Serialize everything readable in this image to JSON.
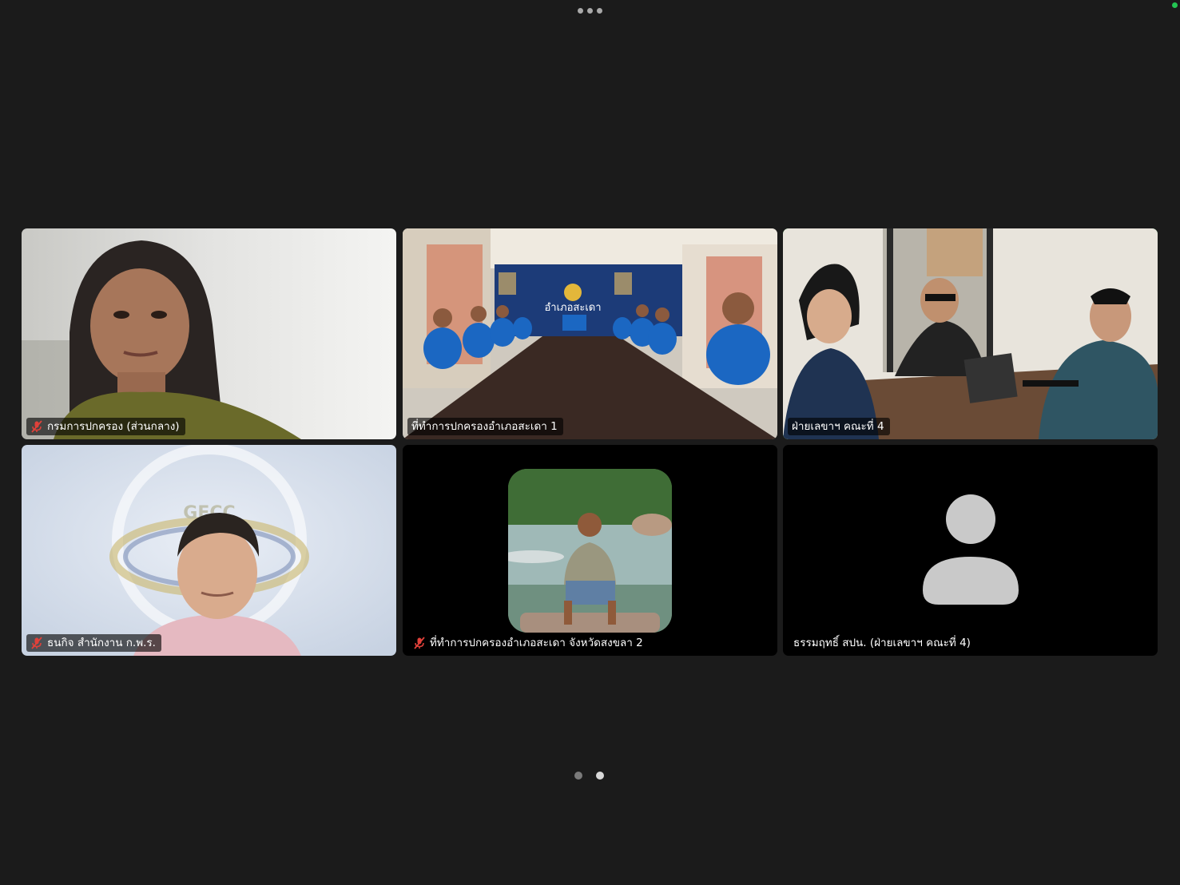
{
  "window": {
    "more_icon": "more-options-icon",
    "connection_status_color": "#23c552"
  },
  "participants": [
    {
      "name": "กรมการปกครอง (ส่วนกลาง)",
      "muted": true,
      "video": "on"
    },
    {
      "name": "ที่ทำการปกครองอำเภอสะเดา 1",
      "muted": false,
      "video": "on"
    },
    {
      "name": "ฝ่ายเลขาฯ คณะที่ 4",
      "muted": false,
      "video": "on",
      "active_speaker": true
    },
    {
      "name": "ธนกิจ สำนักงาน ก.พ.ร.",
      "muted": true,
      "video": "on"
    },
    {
      "name": "ที่ทำการปกครองอำเภอสะเดา จังหวัดสงขลา 2",
      "muted": true,
      "video": "off",
      "avatar": "profile-photo"
    },
    {
      "name": "ธรรมฤทธิ์ สปน. (ฝ่ายเลขาฯ คณะที่ 4)",
      "muted": false,
      "video": "off",
      "avatar": "default-person-icon"
    }
  ],
  "room_sign": {
    "title": "อำเภอสะเดา"
  },
  "backdrop_logo": {
    "text": "GECC"
  },
  "pagination": {
    "pages": 2,
    "current": 2
  },
  "colors": {
    "background": "#1b1b1b",
    "active_speaker_border": "#2fd05a",
    "muted_icon": "#e0413a"
  }
}
